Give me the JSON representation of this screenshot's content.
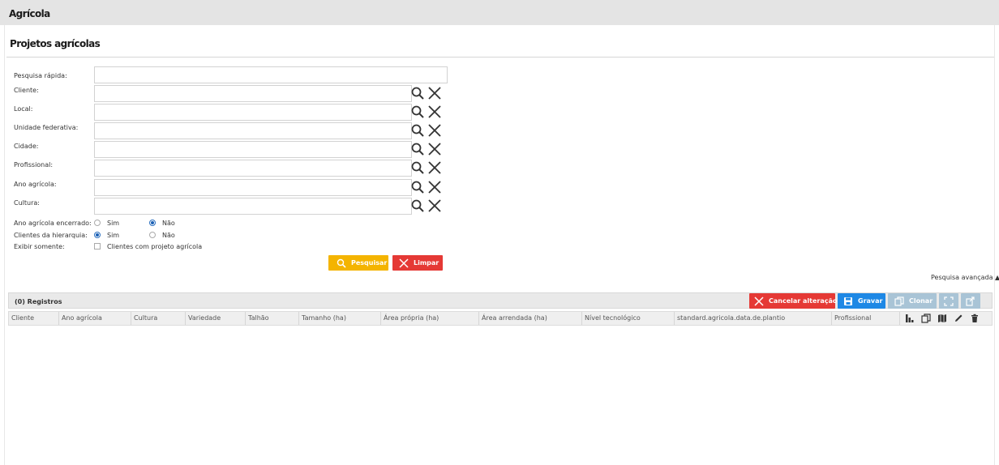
{
  "app": {
    "title": "Agrícola"
  },
  "page": {
    "title": "Projetos agrícolas"
  },
  "filters": {
    "quick_search_label": "Pesquisa rápida:",
    "lookups": [
      {
        "label": "Cliente:"
      },
      {
        "label": "Local:"
      },
      {
        "label": "Unidade federativa:"
      },
      {
        "label": "Cidade:"
      },
      {
        "label": "Profissional:"
      },
      {
        "label": "Ano agrícola:"
      },
      {
        "label": "Cultura:"
      }
    ],
    "ano_encerrado": {
      "label": "Ano agrícola encerrado:",
      "opt_yes": "Sim",
      "opt_no": "Não",
      "selected": "Não"
    },
    "hierarquia": {
      "label": "Clientes da hierarquia:",
      "opt_yes": "Sim",
      "opt_no": "Não",
      "selected": "Sim"
    },
    "exibir": {
      "label": "Exibir somente:",
      "checkbox_label": "Clientes com projeto agrícola",
      "checked": false
    }
  },
  "actions": {
    "search": "Pesquisar",
    "clear": "Limpar",
    "advanced": "Pesquisa avançada ▲"
  },
  "grid": {
    "records": "(0) Registros",
    "cancel": "Cancelar alteração",
    "save": "Gravar",
    "clone": "Clonar",
    "columns": [
      "Cliente",
      "Ano agrícola",
      "Cultura",
      "Variedade",
      "Talhão",
      "Tamanho (ha)",
      "Área própria (ha)",
      "Área arrendada (ha)",
      "Nível tecnológico",
      "standard.agricola.data.de.plantio",
      "Profissional"
    ]
  },
  "colors": {
    "search": "#f4b400",
    "danger": "#e53935",
    "primary": "#1e88e5",
    "disabled": "#a9c4d6"
  }
}
